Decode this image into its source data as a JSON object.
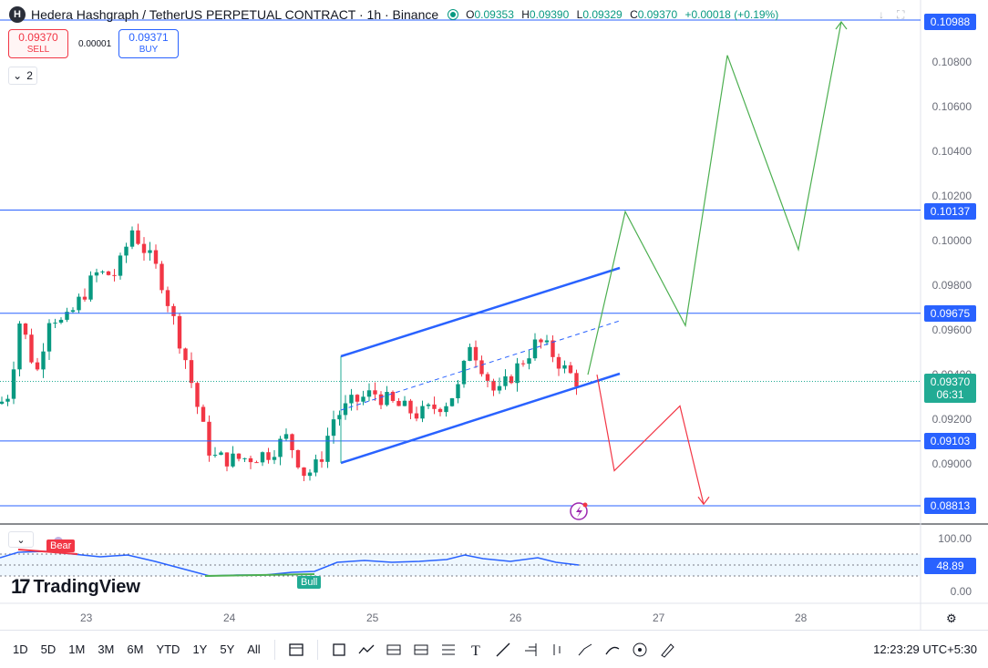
{
  "header": {
    "symbol_title": "Hedera Hashgraph / TetherUS PERPETUAL CONTRACT · 1h · Binance",
    "logo_letter": "H",
    "ohlc": {
      "o_label": "O",
      "o": "0.09353",
      "h_label": "H",
      "h": "0.09390",
      "l_label": "L",
      "l": "0.09329",
      "c_label": "C",
      "c": "0.09370",
      "change": "+0.00018 (+0.19%)"
    }
  },
  "trade": {
    "sell_price": "0.09370",
    "sell_label": "SELL",
    "spread": "0.00001",
    "buy_price": "0.09371",
    "buy_label": "BUY"
  },
  "indicator_toggle": {
    "count": "2"
  },
  "price_axis": {
    "ticks": [
      "0.10800",
      "0.10600",
      "0.10400",
      "0.10200",
      "0.10000",
      "0.09800",
      "0.09600",
      "0.09400",
      "0.09200",
      "0.09000"
    ],
    "labels": {
      "p1": "0.10988",
      "p2": "0.10137",
      "p3": "0.09675",
      "current": "0.09370",
      "countdown": "06:31",
      "p4": "0.09103",
      "p5": "0.08813"
    },
    "colors": {
      "blue": "#2962ff",
      "green": "#22ab94"
    }
  },
  "oscillator": {
    "ticks": [
      "100.00",
      "0.00"
    ],
    "value": "48.89",
    "bear_tag": "Bear",
    "bull_tag": "Bull"
  },
  "time_axis": {
    "labels": [
      "23",
      "24",
      "25",
      "26",
      "27",
      "28"
    ]
  },
  "brand": {
    "name": "TradingView"
  },
  "toolbar": {
    "timeframes": [
      "1D",
      "5D",
      "1M",
      "3M",
      "6M",
      "YTD",
      "1Y",
      "5Y",
      "All"
    ],
    "clock": "12:23:29 UTC+5:30"
  },
  "chart_data": {
    "type": "candlestick",
    "symbol": "HBARUSDT.P",
    "interval": "1h",
    "y_range": [
      0.0876,
      0.11
    ],
    "horizontal_levels": [
      0.10988,
      0.10137,
      0.09675,
      0.09103,
      0.08813
    ],
    "last_price": 0.0937,
    "bullish_projection": [
      0.094,
      0.1013,
      0.0962,
      0.1083,
      0.0996,
      0.1098
    ],
    "bearish_projection": [
      0.094,
      0.0897,
      0.0926,
      0.0882
    ],
    "up_color": "#089981",
    "down_color": "#f23645"
  }
}
